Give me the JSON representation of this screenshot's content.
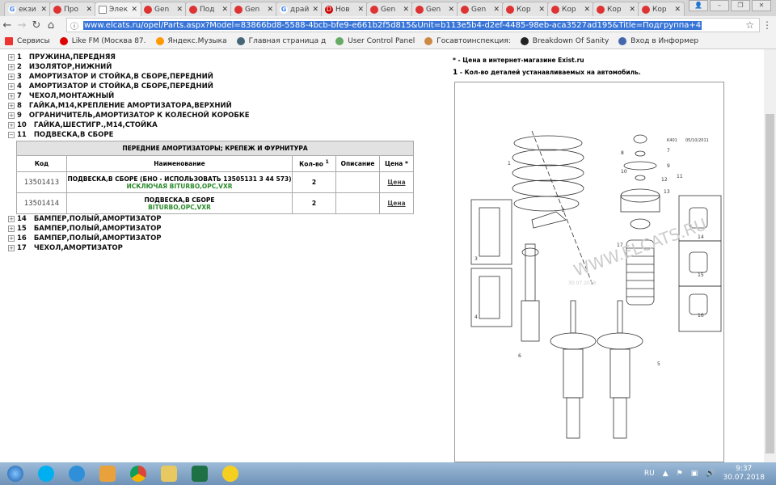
{
  "browser": {
    "tabs": [
      {
        "title": "екзи",
        "icon": "google"
      },
      {
        "title": "Про",
        "icon": "elcats"
      },
      {
        "title": "Элек",
        "icon": "page",
        "active": true
      },
      {
        "title": "Gen",
        "icon": "elcats"
      },
      {
        "title": "Под",
        "icon": "elcats"
      },
      {
        "title": "Gen",
        "icon": "elcats"
      },
      {
        "title": "драй",
        "icon": "google"
      },
      {
        "title": "Нов",
        "icon": "d"
      },
      {
        "title": "Gen",
        "icon": "elcats"
      },
      {
        "title": "Gen",
        "icon": "elcats"
      },
      {
        "title": "Gen",
        "icon": "elcats"
      },
      {
        "title": "Кор",
        "icon": "elcats"
      },
      {
        "title": "Кор",
        "icon": "elcats"
      },
      {
        "title": "Кор",
        "icon": "elcats"
      },
      {
        "title": "Кор",
        "icon": "elcats"
      }
    ],
    "url": "www.elcats.ru/opel/Parts.aspx?Model=83866bd8-5588-4bcb-bfe9-e661b2f5d815&Unit=b113e5b4-d2ef-4485-98eb-aca3527ad195&Title=Подгруппа+4",
    "bookmarks": [
      "Сервисы",
      "Like FM (Москва 87.",
      "Яндекс.Музыка",
      "Главная страница д",
      "User Control Panel",
      "Госавтоинспекция:",
      "Breakdown Of Sanity",
      "Вход в Информер"
    ]
  },
  "tree_top": [
    {
      "num": "1",
      "label": "ПРУЖИНА,ПЕРЕДНЯЯ"
    },
    {
      "num": "2",
      "label": "ИЗОЛЯТОР,НИЖНИЙ"
    },
    {
      "num": "3",
      "label": "АМОРТИЗАТОР И СТОЙКА,В СБОРЕ,ПЕРЕДНИЙ"
    },
    {
      "num": "4",
      "label": "АМОРТИЗАТОР И СТОЙКА,В СБОРЕ,ПЕРЕДНИЙ"
    },
    {
      "num": "7",
      "label": "ЧЕХОЛ,МОНТАЖНЫЙ"
    },
    {
      "num": "8",
      "label": "ГАЙКА,М14,КРЕПЛЕНИЕ АМОРТИЗАТОРА,ВЕРХНИЙ"
    },
    {
      "num": "9",
      "label": "ОГРАНИЧИТЕЛЬ,АМОРТИЗАТОР К КОЛЕСНОЙ КОРОБКЕ"
    },
    {
      "num": "10",
      "label": "ГАЙКА,ШЕСТИГР.,М14,СТОЙКА"
    },
    {
      "num": "11",
      "label": "ПОДВЕСКА,В СБОРЕ",
      "expanded": true
    }
  ],
  "table": {
    "caption": "ПЕРЕДНИЕ АМОРТИЗАТОРЫ; КРЕПЕЖ И ФУРНИТУРА",
    "headers": {
      "code": "Код",
      "name": "Наименование",
      "qty": "Кол-во",
      "qty_sup": "1",
      "desc": "Описание",
      "price": "Цена *"
    },
    "rows": [
      {
        "code": "13501413",
        "name": "ПОДВЕСКА,В СБОРЕ (БНО - ИСПОЛЬЗОВАТЬ 13505131 3 44 573)",
        "note": "ИСКЛЮЧАЯ BITURBO,OPC,VXR",
        "qty": "2",
        "desc": "",
        "price": "Цена"
      },
      {
        "code": "13501414",
        "name": "ПОДВЕСКА,В СБОРЕ",
        "note": "BITURBO,OPC,VXR",
        "qty": "2",
        "desc": "",
        "price": "Цена"
      }
    ]
  },
  "tree_bottom": [
    {
      "num": "14",
      "label": "БАМПЕР,ПОЛЫЙ,АМОРТИЗАТОР"
    },
    {
      "num": "15",
      "label": "БАМПЕР,ПОЛЫЙ,АМОРТИЗАТОР"
    },
    {
      "num": "16",
      "label": "БАМПЕР,ПОЛЫЙ,АМОРТИЗАТОР"
    },
    {
      "num": "17",
      "label": "ЧЕХОЛ,АМОРТИЗАТОР"
    }
  ],
  "notes": {
    "star_mark": "*",
    "star_text": " - Цена в интернет-магазине Exist.ru",
    "one_mark": "1",
    "one_text": " - Кол-во деталей устанавливаемых на автомобиль."
  },
  "diagram": {
    "ref": "K401",
    "date": "05/10/2011",
    "watermark": "WWW.ELCATS.RU",
    "wm_date": "30.07.2018",
    "labels": [
      "1",
      "2",
      "3",
      "4",
      "5",
      "6",
      "7",
      "8",
      "9",
      "10",
      "11",
      "12",
      "13",
      "14",
      "15",
      "16",
      "17"
    ]
  },
  "taskbar": {
    "lang": "RU",
    "time": "9:37",
    "date": "30.07.2018"
  }
}
